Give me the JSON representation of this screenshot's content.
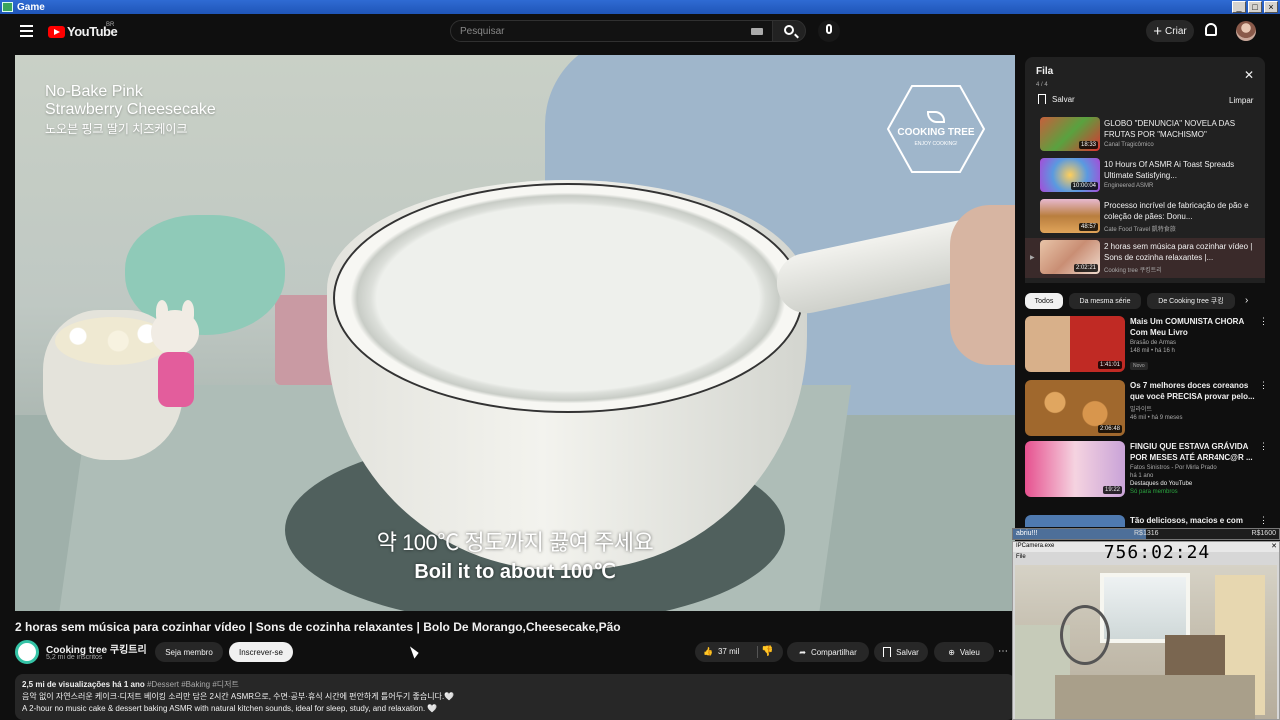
{
  "window": {
    "title": "Game"
  },
  "header": {
    "logo_text": "YouTube",
    "country": "BR",
    "search_placeholder": "Pesquisar",
    "create_label": "Criar"
  },
  "video": {
    "overlay_title_line1": "No-Bake Pink",
    "overlay_title_line2": "Strawberry Cheesecake",
    "overlay_title_korean": "노오븐 핑크 딸기 치즈케이크",
    "badge_title": "COOKING TREE",
    "badge_subtitle": "ENJOY COOKING!",
    "subtitle_korean": "약 100℃ 정도까지 끓여 주세요",
    "subtitle_english": "Boil it to about 100℃",
    "title": "2 horas sem música para cozinhar vídeo | Sons de cozinha relaxantes | Bolo De Morango,Cheesecake,Pão",
    "channel": "Cooking tree 쿠킹트리",
    "subscribers": "5,2 mi de inscritos",
    "join_label": "Seja membro",
    "subscribe_label": "Inscrever-se",
    "likes": "37 mil",
    "share_label": "Compartilhar",
    "save_label": "Salvar",
    "thanks_label": "Valeu",
    "more_label": "⋯"
  },
  "description": {
    "views": "2,5 mi de visualizações",
    "age": "há 1 ano",
    "tags": "#Dessert #Baking #디저트",
    "line_korean": "음악 없이 자연스러운 케이크·디저트 베이킹 소리만 담은 2시간 ASMR으로, 수면·공부·휴식 시간에 편안하게 틀어두기 좋습니다.🤍",
    "line_english": "A 2-hour no music cake & dessert baking ASMR with natural kitchen sounds, ideal for sleep, study, and relaxation. 🤍"
  },
  "queue": {
    "title": "Fila",
    "count": "4 / 4",
    "save_label": "Salvar",
    "clear_label": "Limpar",
    "close_label": "✕",
    "items": [
      {
        "title": "GLOBO \"DENUNCIA\" NOVELA DAS FRUTAS POR \"MACHISMO\"",
        "channel": "Canal Tragicômico",
        "duration": "18:33",
        "color": "#b54a3c"
      },
      {
        "title": "10 Hours Of ASMR Ai Toast Spreads Ultimate Satisfying...",
        "channel": "Engineered ASMR",
        "duration": "10:00:04",
        "color": "#7d4bb3"
      },
      {
        "title": "Processo incrível de fabricação de pão e coleção de pães: Donu...",
        "channel": "Cate Food Travel 凱特食旅",
        "duration": "48:57",
        "color": "#b98a4c"
      },
      {
        "title": "2 horas sem música para cozinhar vídeo | Sons de cozinha relaxantes |...",
        "channel": "Cooking tree 쿠킹트리",
        "duration": "2:02:21",
        "color": "#c98e74",
        "active": true
      }
    ]
  },
  "chips": [
    "Todos",
    "Da mesma série",
    "De Cooking tree 쿠킹"
  ],
  "recommendations": [
    {
      "title": "Mais Um COMUNISTA CHORA Com Meu Livro",
      "channel": "Brasão de Armas",
      "stats": "148 mil • há 16 h",
      "duration": "1:41:01",
      "badge": "Novo",
      "color": "#c23a2e"
    },
    {
      "title": "Os 7 melhores doces coreanos que você PRECISA provar pelo...",
      "channel": "밀라이트",
      "stats": "46 mil • há 9 meses",
      "duration": "2:06:48",
      "color": "#b97d3d"
    },
    {
      "title": "FINGIU QUE ESTAVA GRÁVIDA POR MESES ATÉ ARR4NC@R ...",
      "channel": "Fatos Sinistros - Por Mirla Prado",
      "stats": "há 1 ano",
      "duration": "19:22",
      "highlight": "Destaques do YouTube",
      "member": "Só para membros",
      "color": "#d44a8a"
    },
    {
      "title": "Tão deliciosos, macios e com",
      "channel": "",
      "stats": "",
      "duration": "",
      "color": "#4f7ab0"
    }
  ],
  "overlay": {
    "donation_label": "abriu!!!",
    "donation_current": "R$1316",
    "donation_goal": "R$1600",
    "donation_progress": 0.5,
    "cam_title": "IPCamera.exe",
    "cam_menu": "File",
    "timer": "756:02:24"
  }
}
